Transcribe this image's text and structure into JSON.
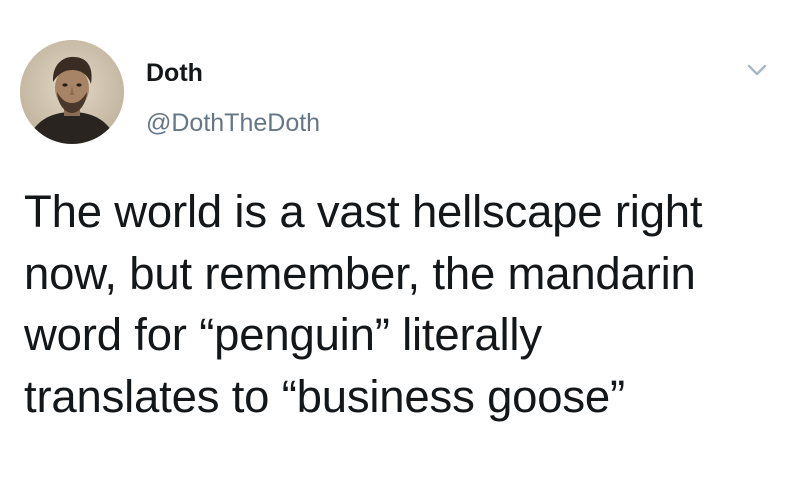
{
  "tweet": {
    "author": {
      "display_name": "Doth",
      "handle": "@DothTheDoth",
      "avatar_icon": "avatar-portrait"
    },
    "menu_icon": "chevron-down-icon",
    "text_lines": [
      "The world is a vast hellscape right",
      "now, but remember, the mandarin",
      "word for “penguin” literally",
      "translates to “business goose”"
    ]
  },
  "colors": {
    "background": "#ffffff",
    "name_text": "#14171a",
    "handle_text": "#657786",
    "chevron": "#aab8c2"
  }
}
